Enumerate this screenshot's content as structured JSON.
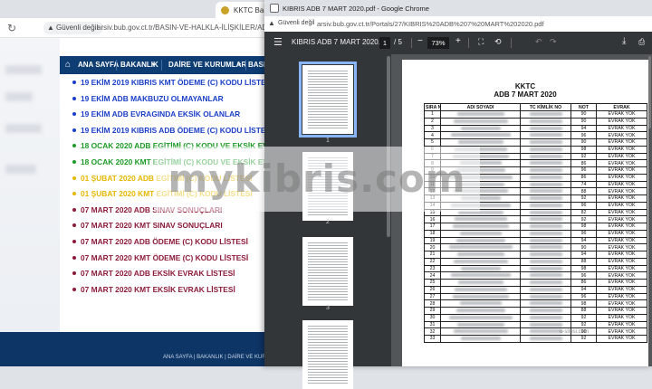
{
  "colors": {
    "site_nav_bg": "#0e3d73",
    "blue_link": "#1a3ec8",
    "green_link": "#1c9a26",
    "yellow_link": "#e6b800",
    "maroon_link": "#8c1b3a",
    "pdf_chrome": "#323639",
    "thumb_selected": "#8ab4f8"
  },
  "bg_browser": {
    "tab_title": "KKTC Ba",
    "security_label": "Güvenli değil",
    "url": "arsiv.bub.gov.ct.tr/BASIN-VE-HALKLA-İLİŞKİLER/ADB-KMT",
    "nav": {
      "home": "ANA SAYFA",
      "bakanlik": "BAKANLIK",
      "daire": "DAİRE VE KURUMLAR",
      "basin": "BASIN"
    },
    "links": [
      {
        "text": "19 EKİM 2019 KIBRIS KMT ÖDEME (C) KODU LİSTESİ",
        "color": "blue"
      },
      {
        "text": "19 EKİM ADB MAKBUZU OLMAYANLAR",
        "color": "blue"
      },
      {
        "text": "19 EKİM ADB EVRAGINDA EKSİK OLANLAR",
        "color": "blue"
      },
      {
        "text": "19 EKİM 2019 KIBRIS ADB ÖDEME (C) KODU LİSTESİ",
        "color": "blue"
      },
      {
        "text": "18 OCAK 2020 ADB EGİTİMİ (C) KODU VE EKSİK EVRAK",
        "color": "green"
      },
      {
        "text": "18 OCAK 2020 KMT EGİTİMİ (C) KODU VE EKSİK EVRAK",
        "color": "green"
      },
      {
        "text": "01 ŞUBAT 2020 ADB EGİTİMİ (C) KODU LİSTESİ",
        "color": "yellow"
      },
      {
        "text": "01 ŞUBAT 2020 KMT EGİTİMİ (C) KODU LİSTESİ",
        "color": "yellow"
      },
      {
        "text": "07 MART 2020 ADB SINAV SONUÇLARI",
        "color": "maroon"
      },
      {
        "text": "07 MART 2020 KMT SINAV SONUÇLARI",
        "color": "maroon"
      },
      {
        "text": "07 MART 2020 ADB ÖDEME (C) KODU LİSTESİ",
        "color": "maroon"
      },
      {
        "text": "07 MART 2020 KMT ÖDEME (C) KODU LİSTESİ",
        "color": "maroon"
      },
      {
        "text": "07 MART 2020 ADB EKSİK EVRAK LİSTESİ",
        "color": "maroon"
      },
      {
        "text": "07 MART 2020 KMT EKSİK EVRAK LİSTESİ",
        "color": "maroon"
      }
    ],
    "footer_text": "ANA SAYFA  |  BAKANLIK  |  DAİRE VE KURUMLAR"
  },
  "pdf_window": {
    "title": "KIBRIS ADB 7 MART 2020.pdf - Google Chrome",
    "security_label": "Güvenli değil",
    "url": "arsiv.bub.gov.ct.tr/Portals/27/KIBRIS%20ADB%207%20MART%202020.pdf",
    "toolbar": {
      "file_name": "KIBRIS ADB 7 MART 2020...",
      "current_page": "1",
      "total_pages": "/ 5",
      "zoom": "73%",
      "minus": "−",
      "plus": "+"
    },
    "thumb_numbers": [
      "1",
      "2",
      "3"
    ],
    "document": {
      "title_line1": "KKTC",
      "title_line2": "ADB 7 MART 2020",
      "headers": [
        "SIRA N",
        "ADI SOYADI",
        "TC KİMLİK NO",
        "NOT",
        "EVRAK"
      ],
      "rows": [
        {
          "sira": "1",
          "not": "90",
          "evrak": "EVRAK YOK"
        },
        {
          "sira": "2",
          "not": "90",
          "evrak": "EVRAK YOK"
        },
        {
          "sira": "3",
          "not": "94",
          "evrak": "EVRAK YOK"
        },
        {
          "sira": "4",
          "not": "96",
          "evrak": "EVRAK YOK"
        },
        {
          "sira": "5",
          "not": "90",
          "evrak": "EVRAK YOK"
        },
        {
          "sira": "6",
          "not": "98",
          "evrak": "EVRAK YOK"
        },
        {
          "sira": "7",
          "not": "92",
          "evrak": "EVRAK YOK"
        },
        {
          "sira": "8",
          "not": "86",
          "evrak": "EVRAK YOK"
        },
        {
          "sira": "9",
          "not": "96",
          "evrak": "EVRAK YOK"
        },
        {
          "sira": "10",
          "not": "86",
          "evrak": "EVRAK YOK"
        },
        {
          "sira": "11",
          "not": "74",
          "evrak": "EVRAK YOK"
        },
        {
          "sira": "12",
          "not": "88",
          "evrak": "EVRAK YOK"
        },
        {
          "sira": "13",
          "not": "92",
          "evrak": "EVRAK YOK"
        },
        {
          "sira": "14",
          "not": "96",
          "evrak": "EVRAK YOK"
        },
        {
          "sira": "15",
          "not": "82",
          "evrak": "EVRAK YOK"
        },
        {
          "sira": "16",
          "not": "92",
          "evrak": "EVRAK YOK"
        },
        {
          "sira": "17",
          "not": "98",
          "evrak": "EVRAK YOK"
        },
        {
          "sira": "18",
          "not": "96",
          "evrak": "EVRAK YOK"
        },
        {
          "sira": "19",
          "not": "94",
          "evrak": "EVRAK YOK"
        },
        {
          "sira": "20",
          "not": "90",
          "evrak": "EVRAK YOK"
        },
        {
          "sira": "21",
          "not": "94",
          "evrak": "EVRAK YOK"
        },
        {
          "sira": "22",
          "not": "88",
          "evrak": "EVRAK YOK"
        },
        {
          "sira": "23",
          "not": "98",
          "evrak": "EVRAK YOK"
        },
        {
          "sira": "24",
          "not": "96",
          "evrak": "EVRAK YOK"
        },
        {
          "sira": "25",
          "not": "86",
          "evrak": "EVRAK YOK"
        },
        {
          "sira": "26",
          "not": "94",
          "evrak": "EVRAK YOK"
        },
        {
          "sira": "27",
          "not": "96",
          "evrak": "EVRAK YOK"
        },
        {
          "sira": "28",
          "not": "98",
          "evrak": "EVRAK YOK"
        },
        {
          "sira": "29",
          "not": "88",
          "evrak": "EVRAK YOK"
        },
        {
          "sira": "30",
          "not": "92",
          "evrak": "EVRAK YOK"
        },
        {
          "sira": "31",
          "not": "92",
          "evrak": "EVRAK YOK"
        },
        {
          "sira": "32",
          "not": "90",
          "evrak": "EVRAK YOK"
        },
        {
          "sira": "33",
          "not": "92",
          "evrak": "EVRAK YOK"
        }
      ]
    }
  },
  "watermark": {
    "main": "mykibris.com",
    "small": "u-sitesi.com"
  }
}
